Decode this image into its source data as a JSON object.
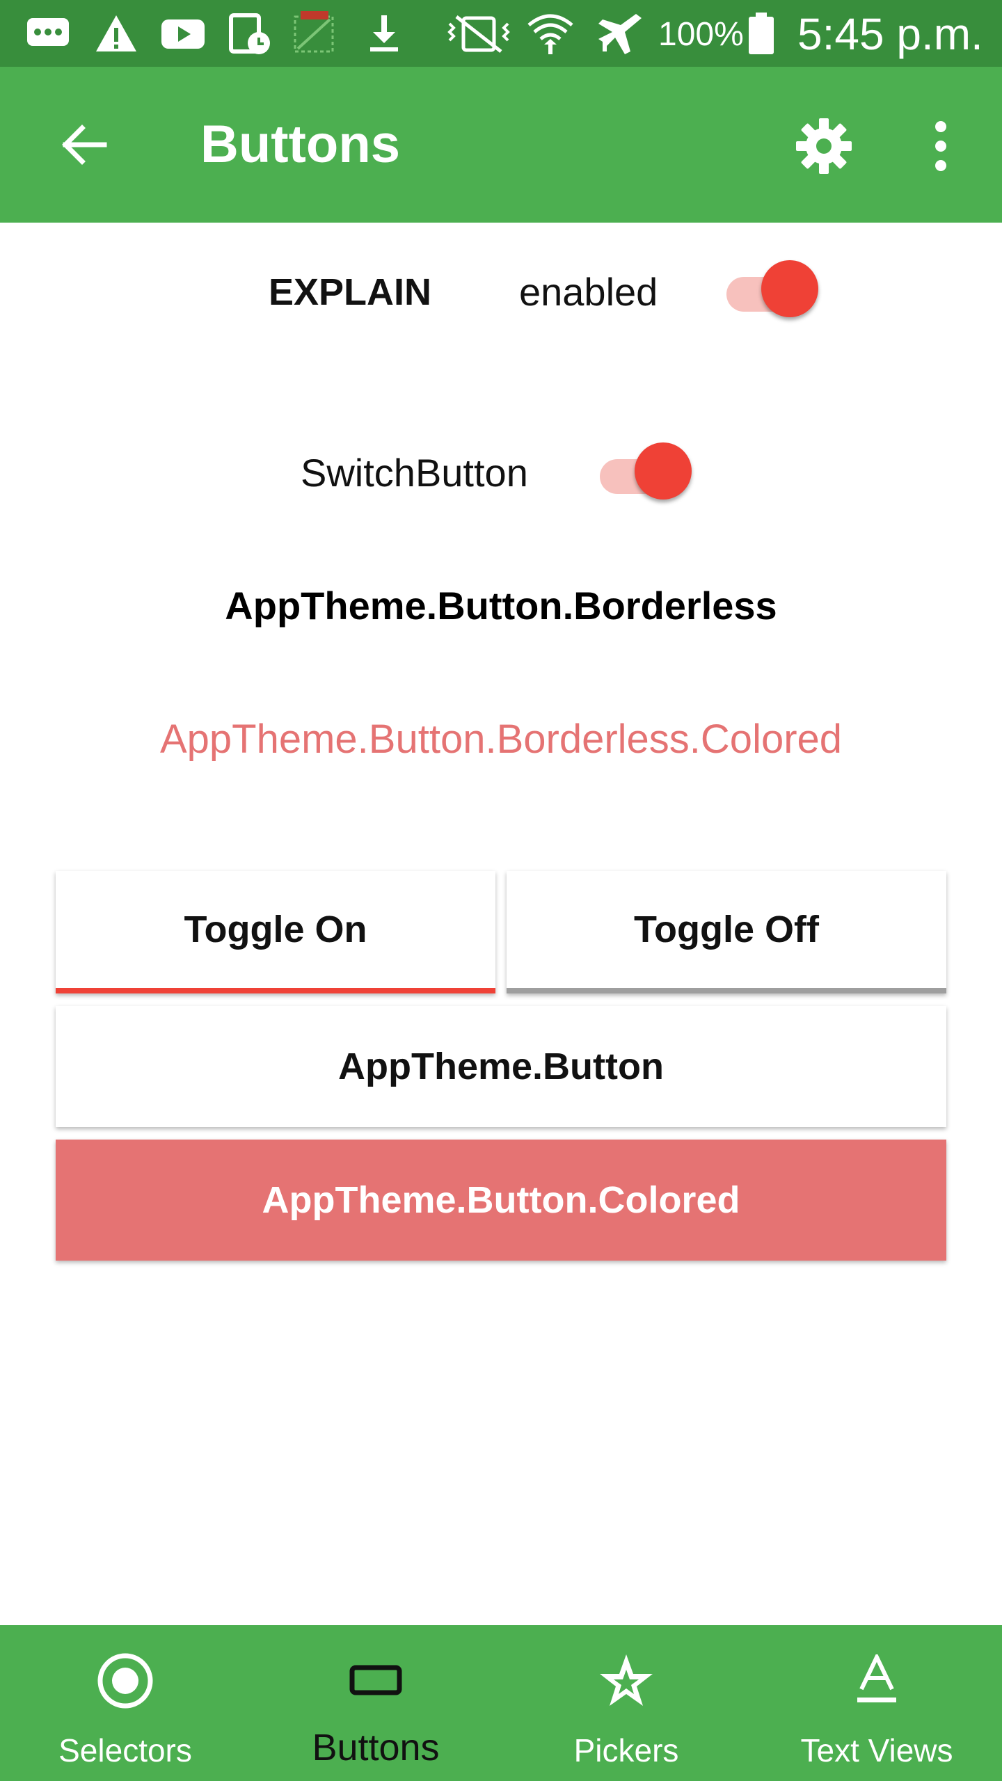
{
  "status_bar": {
    "battery": "100%",
    "time": "5:45 p.m.",
    "icons": [
      "sms-icon",
      "warning-icon",
      "youtube-icon",
      "device-clock-icon",
      "fake-gps-icon",
      "download-icon",
      "vibrate-off-icon",
      "wifi-icon",
      "airplane-icon",
      "battery-icon"
    ]
  },
  "toolbar": {
    "title": "Buttons",
    "back_icon": "arrow-left-icon",
    "settings_icon": "gear-icon",
    "more_icon": "more-vert-icon"
  },
  "explain": {
    "label": "EXPLAIN",
    "state_label": "enabled",
    "switch_on": true
  },
  "switch_button": {
    "label": "SwitchButton",
    "on": true
  },
  "buttons": {
    "borderless": "AppTheme.Button.Borderless",
    "borderless_colored": "AppTheme.Button.Borderless.Colored",
    "toggle_on": "Toggle On",
    "toggle_off": "Toggle Off",
    "button": "AppTheme.Button",
    "button_colored": "AppTheme.Button.Colored"
  },
  "bottom_nav": {
    "items": [
      {
        "label": "Selectors",
        "icon": "radio-button-icon",
        "active": false
      },
      {
        "label": "Buttons",
        "icon": "button-outline-icon",
        "active": true
      },
      {
        "label": "Pickers",
        "icon": "star-outline-icon",
        "active": false
      },
      {
        "label": "Text Views",
        "icon": "text-format-icon",
        "active": false
      }
    ]
  },
  "colors": {
    "primary": "#4caf50",
    "primary_dark": "#388e3c",
    "accent": "#ef4136",
    "colored_button": "#e57373"
  }
}
